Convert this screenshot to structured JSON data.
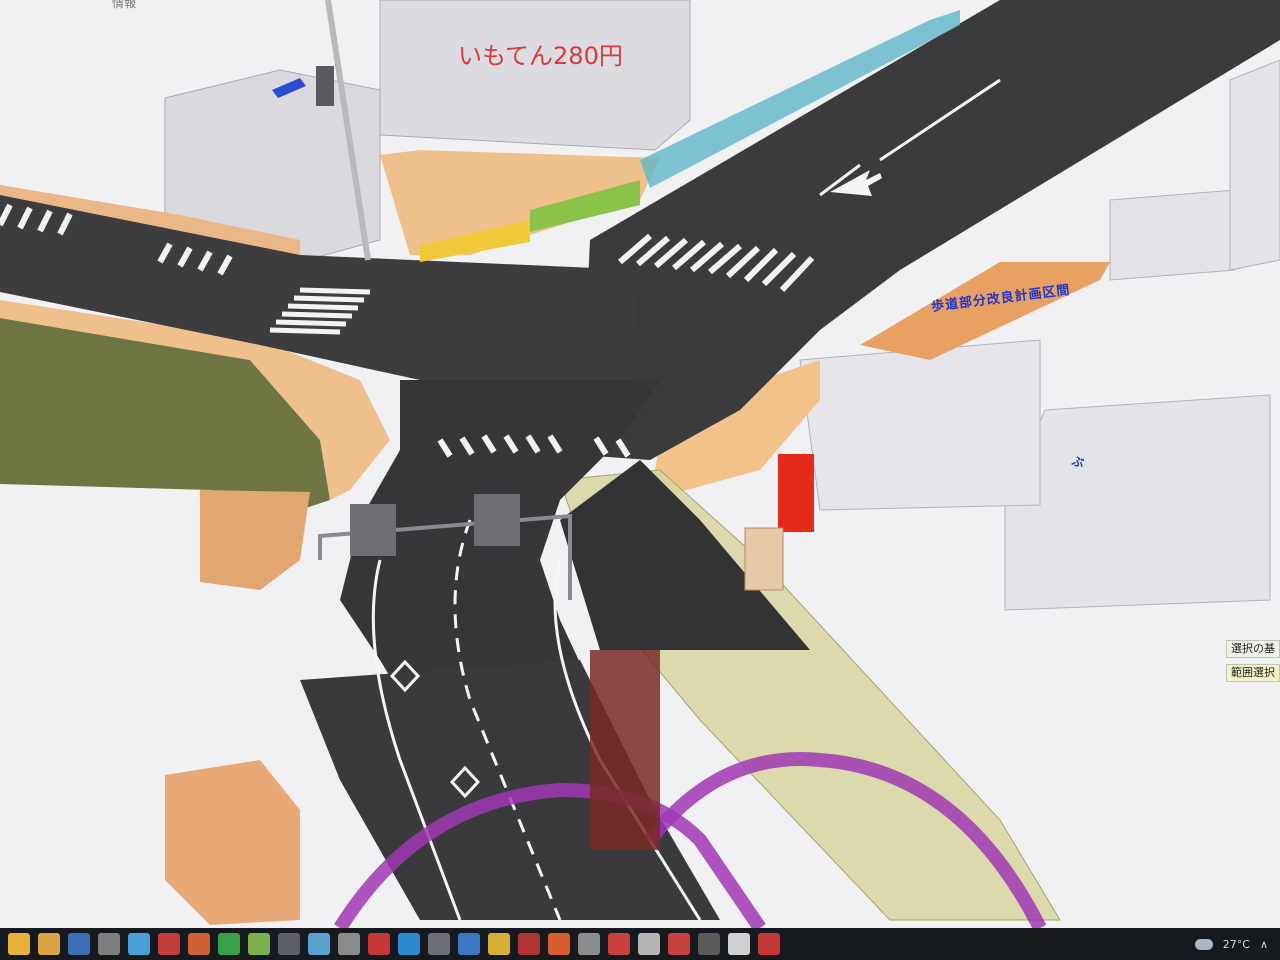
{
  "scene": {
    "shop_sign": "いもてん280円",
    "top_left_label": "情報",
    "blue_label_1": "歩道部分改良計画区間",
    "blue_label_2": "ぶ"
  },
  "side_panel": {
    "item_1": "選択の基",
    "item_2": "範囲選択"
  },
  "taskbar": {
    "weather": "27°C",
    "chevron": "∧",
    "icons": [
      "chrome-icon",
      "folder-icon",
      "file-icon",
      "app-icon",
      "app-icon",
      "app-icon",
      "app-icon",
      "app-icon",
      "app-icon",
      "app-icon",
      "app-icon",
      "app-icon",
      "app-icon",
      "app-icon",
      "app-icon",
      "app-icon",
      "app-icon",
      "app-icon",
      "app-icon",
      "app-icon",
      "app-icon",
      "app-icon",
      "app-icon",
      "app-icon",
      "app-icon",
      "app-icon",
      "app-icon",
      "app-icon",
      "app-icon",
      "app-icon",
      "app-icon",
      "app-icon",
      "app-icon",
      "app-icon",
      "app-icon",
      "app-icon"
    ],
    "icon_colors": [
      "#e8b23a",
      "#d9a441",
      "#3b6fb6",
      "#7e7e7e",
      "#4aa0d8",
      "#c43c3c",
      "#cf5f34",
      "#39a04a",
      "#7bb04c",
      "#59606a",
      "#5ba1cf",
      "#8a8a8a",
      "#c43838",
      "#2d8ad1",
      "#6c6f76",
      "#3c77c2",
      "#d6b034",
      "#b13434",
      "#d55e2c",
      "#8c8c8c",
      "#c94040",
      "#b4b4b4",
      "#c94040",
      "#5a5a5a",
      "#d0d0d0",
      "#c43838"
    ]
  }
}
